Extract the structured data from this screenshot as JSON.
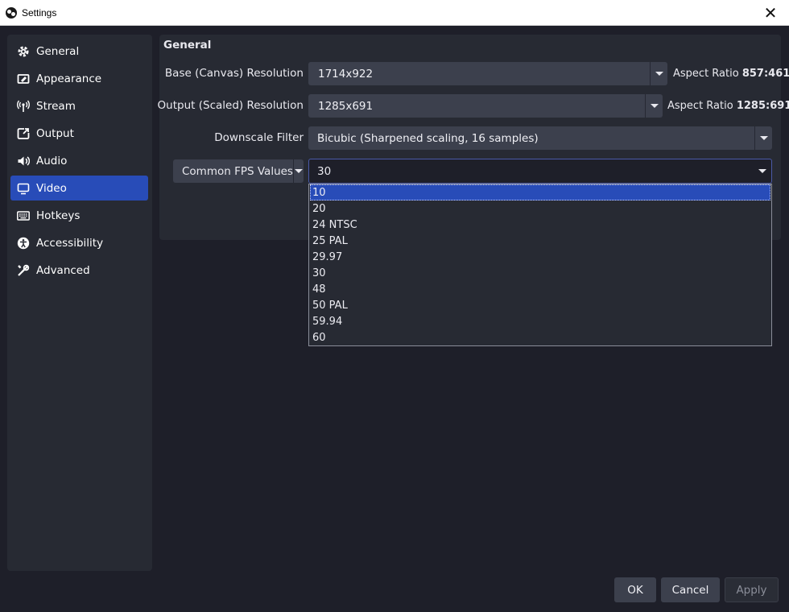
{
  "window": {
    "title": "Settings",
    "close_glyph": "✕"
  },
  "sidebar": {
    "items": [
      {
        "label": "General",
        "icon": "gear-icon",
        "active": false
      },
      {
        "label": "Appearance",
        "icon": "appearance-icon",
        "active": false
      },
      {
        "label": "Stream",
        "icon": "stream-icon",
        "active": false
      },
      {
        "label": "Output",
        "icon": "output-icon",
        "active": false
      },
      {
        "label": "Audio",
        "icon": "audio-icon",
        "active": false
      },
      {
        "label": "Video",
        "icon": "video-icon",
        "active": true
      },
      {
        "label": "Hotkeys",
        "icon": "keyboard-icon",
        "active": false
      },
      {
        "label": "Accessibility",
        "icon": "accessibility-icon",
        "active": false
      },
      {
        "label": "Advanced",
        "icon": "tools-icon",
        "active": false
      }
    ]
  },
  "general": {
    "title": "General",
    "base_resolution": {
      "label": "Base (Canvas) Resolution",
      "value": "1714x922",
      "aspect_label": "Aspect Ratio",
      "aspect_value": "857:461"
    },
    "output_resolution": {
      "label": "Output (Scaled) Resolution",
      "value": "1285x691",
      "aspect_label": "Aspect Ratio",
      "aspect_value": "1285:691"
    },
    "downscale_filter": {
      "label": "Downscale Filter",
      "value": "Bicubic (Sharpened scaling, 16 samples)"
    },
    "fps": {
      "type_label": "Common FPS Values",
      "value": "30",
      "options": [
        "10",
        "20",
        "24 NTSC",
        "25 PAL",
        "29.97",
        "30",
        "48",
        "50 PAL",
        "59.94",
        "60"
      ],
      "highlighted": "10"
    }
  },
  "footer": {
    "ok": "OK",
    "cancel": "Cancel",
    "apply": "Apply"
  },
  "colors": {
    "accent": "#284cb8",
    "background": "#1e1f29",
    "panel": "#272a33",
    "control": "#3c404d"
  }
}
